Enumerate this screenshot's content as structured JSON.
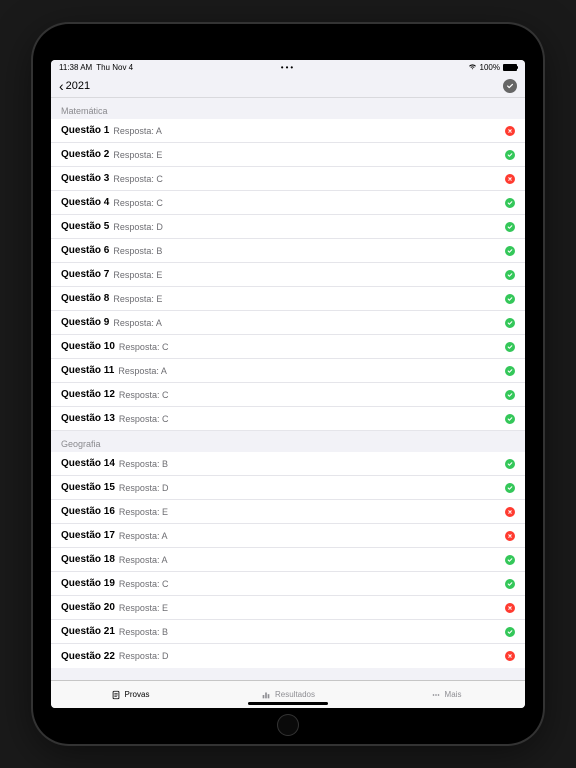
{
  "status": {
    "time": "11:38 AM",
    "date": "Thu Nov 4",
    "battery_pct": "100%"
  },
  "nav": {
    "back_label": "2021"
  },
  "sections": [
    {
      "title": "Matemática",
      "questions": [
        {
          "label": "Questão 1",
          "answer": "Resposta: A",
          "correct": false
        },
        {
          "label": "Questão 2",
          "answer": "Resposta: E",
          "correct": true
        },
        {
          "label": "Questão 3",
          "answer": "Resposta: C",
          "correct": false
        },
        {
          "label": "Questão 4",
          "answer": "Resposta: C",
          "correct": true
        },
        {
          "label": "Questão 5",
          "answer": "Resposta: D",
          "correct": true
        },
        {
          "label": "Questão 6",
          "answer": "Resposta: B",
          "correct": true
        },
        {
          "label": "Questão 7",
          "answer": "Resposta: E",
          "correct": true
        },
        {
          "label": "Questão 8",
          "answer": "Resposta: E",
          "correct": true
        },
        {
          "label": "Questão 9",
          "answer": "Resposta: A",
          "correct": true
        },
        {
          "label": "Questão 10",
          "answer": "Resposta: C",
          "correct": true
        },
        {
          "label": "Questão 11",
          "answer": "Resposta: A",
          "correct": true
        },
        {
          "label": "Questão 12",
          "answer": "Resposta: C",
          "correct": true
        },
        {
          "label": "Questão 13",
          "answer": "Resposta: C",
          "correct": true
        }
      ]
    },
    {
      "title": "Geografia",
      "questions": [
        {
          "label": "Questão 14",
          "answer": "Resposta: B",
          "correct": true
        },
        {
          "label": "Questão 15",
          "answer": "Resposta: D",
          "correct": true
        },
        {
          "label": "Questão 16",
          "answer": "Resposta: E",
          "correct": false
        },
        {
          "label": "Questão 17",
          "answer": "Resposta: A",
          "correct": false
        },
        {
          "label": "Questão 18",
          "answer": "Resposta: A",
          "correct": true
        },
        {
          "label": "Questão 19",
          "answer": "Resposta: C",
          "correct": true
        },
        {
          "label": "Questão 20",
          "answer": "Resposta: E",
          "correct": false
        },
        {
          "label": "Questão 21",
          "answer": "Resposta: B",
          "correct": true
        },
        {
          "label": "Questão 22",
          "answer": "Resposta: D",
          "correct": false
        }
      ]
    }
  ],
  "tabs": {
    "provas": "Provas",
    "resultados": "Resultados",
    "mais": "Mais"
  }
}
